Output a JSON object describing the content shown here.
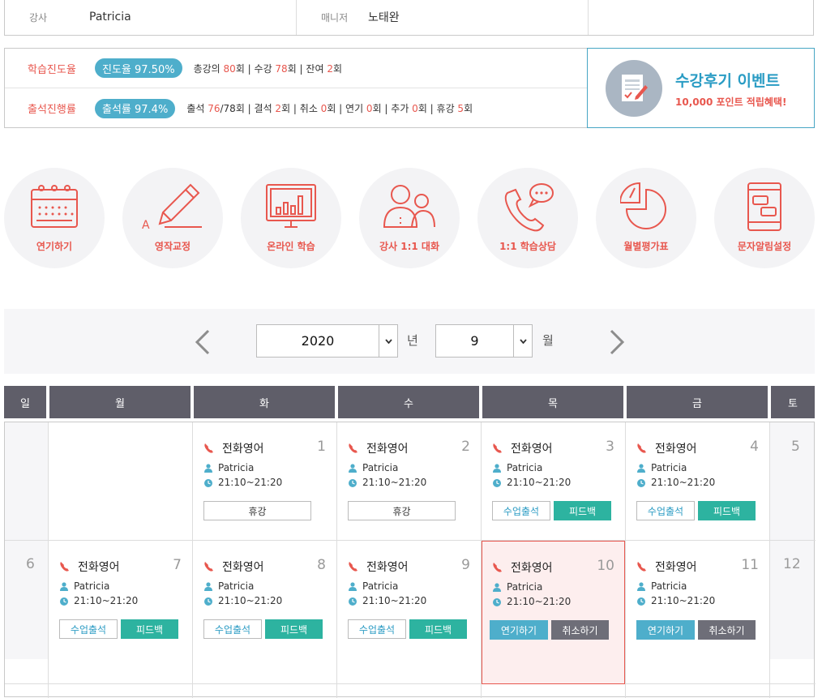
{
  "top_info": {
    "teacher_label": "강사",
    "teacher_value": "Patricia",
    "manager_label": "매니저",
    "manager_value": "노태완"
  },
  "progress": {
    "row1": {
      "label": "학습진도율",
      "pill": "진도율 97.50%",
      "stats": [
        "총강의 ",
        "80",
        "회 | 수강 ",
        "78",
        "회 | 잔여 ",
        "2",
        "회"
      ]
    },
    "row2": {
      "label": "출석진행률",
      "pill": "출석률 97.4%",
      "stats": [
        "출석 ",
        "76",
        "/78회 | 결석 ",
        "2",
        "회 | 취소 ",
        "0",
        "회 | 연기 ",
        "0",
        "회 | 추가 ",
        "0",
        "회 | 휴강 ",
        "5",
        "회"
      ]
    }
  },
  "event": {
    "title": "수강후기 이벤트",
    "subtitle": "10,000 포인트 적립혜택!"
  },
  "menu": [
    {
      "label": "연기하기",
      "icon": "calendar-icon"
    },
    {
      "label": "영작교정",
      "icon": "pencil-icon"
    },
    {
      "label": "온라인 학습",
      "icon": "monitor-chart-icon"
    },
    {
      "label": "강사 1:1 대화",
      "icon": "people-icon"
    },
    {
      "label": "1:1 학습상담",
      "icon": "phone-chat-icon"
    },
    {
      "label": "월별평가표",
      "icon": "pie-chart-icon"
    },
    {
      "label": "문자알림설정",
      "icon": "mobile-message-icon"
    }
  ],
  "selector": {
    "year": "2020",
    "year_unit": "년",
    "month": "9",
    "month_unit": "월"
  },
  "weekdays": [
    "일",
    "월",
    "화",
    "수",
    "목",
    "금",
    "토"
  ],
  "calendar": {
    "week1": {
      "sun": "",
      "sat": "5",
      "days": [
        {
          "num": "1",
          "type": "전화영어",
          "teacher": "Patricia",
          "time": "21:10~21:20",
          "btns": [
            "휴강"
          ]
        },
        {
          "num": "2",
          "type": "전화영어",
          "teacher": "Patricia",
          "time": "21:10~21:20",
          "btns": [
            "휴강"
          ]
        },
        {
          "num": "3",
          "type": "전화영어",
          "teacher": "Patricia",
          "time": "21:10~21:20",
          "btns": [
            "수업출석",
            "피드백"
          ]
        },
        {
          "num": "4",
          "type": "전화영어",
          "teacher": "Patricia",
          "time": "21:10~21:20",
          "btns": [
            "수업출석",
            "피드백"
          ]
        }
      ]
    },
    "week2": {
      "sun": "6",
      "sat": "12",
      "days": [
        {
          "num": "7",
          "type": "전화영어",
          "teacher": "Patricia",
          "time": "21:10~21:20",
          "btns": [
            "수업출석",
            "피드백"
          ]
        },
        {
          "num": "8",
          "type": "전화영어",
          "teacher": "Patricia",
          "time": "21:10~21:20",
          "btns": [
            "수업출석",
            "피드백"
          ]
        },
        {
          "num": "9",
          "type": "전화영어",
          "teacher": "Patricia",
          "time": "21:10~21:20",
          "btns": [
            "수업출석",
            "피드백"
          ]
        },
        {
          "num": "10",
          "type": "전화영어",
          "teacher": "Patricia",
          "time": "21:10~21:20",
          "btns": [
            "연기하기",
            "취소하기"
          ]
        },
        {
          "num": "11",
          "type": "전화영어",
          "teacher": "Patricia",
          "time": "21:10~21:20",
          "btns": [
            "연기하기",
            "취소하기"
          ]
        }
      ]
    }
  },
  "colors": {
    "accent": "#e8574e",
    "teal": "#4eaecb",
    "header": "#5f5e69"
  }
}
